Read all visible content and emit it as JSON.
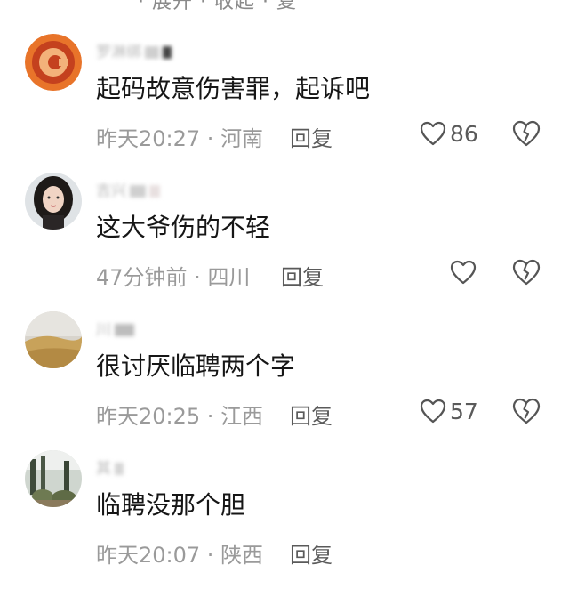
{
  "header_fragment": "· 展开 · 收起 · 复",
  "comments": [
    {
      "username": "罗淋绑",
      "content": "起码故意伤害罪，起诉吧",
      "time": "昨天20:27",
      "separator": " · ",
      "location": "河南",
      "reply_label": "回复",
      "likes": "86",
      "avatar_icon": "orange-logo-avatar"
    },
    {
      "username": "吉兴",
      "content": "这大爷伤的不轻",
      "time": "47分钟前",
      "separator": " · ",
      "location": "四川",
      "reply_label": "回复",
      "likes": "",
      "avatar_icon": "woman-portrait-avatar"
    },
    {
      "username": "川",
      "content": "很讨厌临聘两个字",
      "time": "昨天20:25",
      "separator": " · ",
      "location": "江西",
      "reply_label": "回复",
      "likes": "57",
      "avatar_icon": "desert-landscape-avatar"
    },
    {
      "username": "其",
      "content": "临聘没那个胆",
      "time": "昨天20:07",
      "separator": " · ",
      "location": "陕西",
      "reply_label": "回复",
      "likes": "",
      "avatar_icon": "cactus-photo-avatar"
    }
  ],
  "colors": {
    "text_primary": "#161616",
    "text_meta": "#9a9a9a",
    "icon_stroke": "#555555"
  }
}
